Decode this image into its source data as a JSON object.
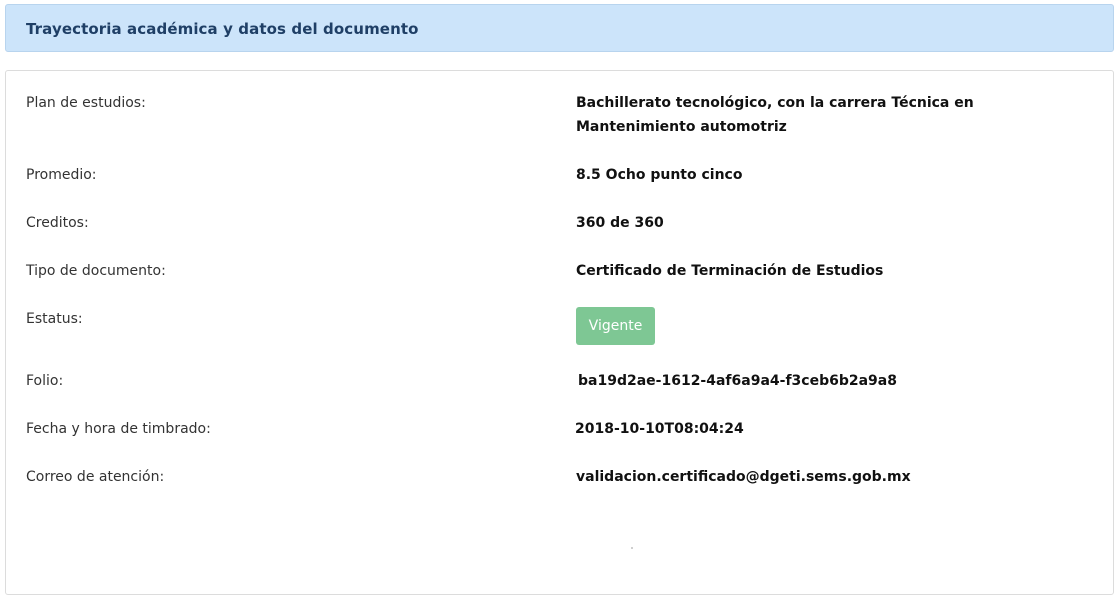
{
  "header": {
    "title": "Trayectoria académica y datos del documento"
  },
  "rows": {
    "plan": {
      "label": "Plan de estudios:",
      "value": "Bachillerato tecnológico, con la carrera Técnica en Mantenimiento automotriz"
    },
    "promedio": {
      "label": "Promedio:",
      "value": "8.5 Ocho punto cinco"
    },
    "creditos": {
      "label": "Creditos:",
      "value": "360 de 360"
    },
    "tipo": {
      "label": "Tipo de documento:",
      "value": "Certificado de Terminación de Estudios"
    },
    "estatus": {
      "label": "Estatus:",
      "value": "Vigente"
    },
    "folio": {
      "label": "Folio:",
      "value": "ba19d2ae-1612-4af6a9a4-f3ceb6b2a9a8"
    },
    "fecha": {
      "label": "Fecha y hora de timbrado:",
      "value": "2018-10-10T08:04:24"
    },
    "correo": {
      "label": "Correo de atención:",
      "value": "validacion.certificado@dgeti.sems.gob.mx"
    }
  },
  "colors": {
    "header_bg": "#cce4fa",
    "header_text": "#1f3f66",
    "status_bg": "#7ec794"
  }
}
